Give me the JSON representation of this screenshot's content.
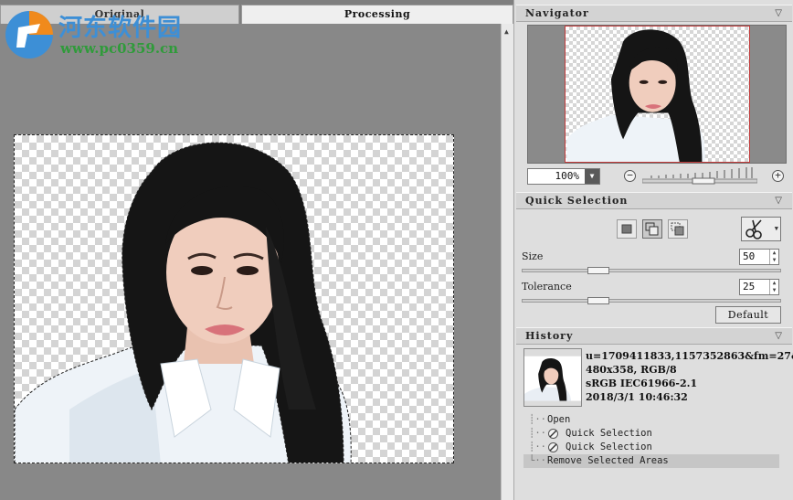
{
  "watermark": {
    "title": "河东软件园",
    "url": "www.pc0359.cn",
    "logo_icon": "watermark-logo-icon",
    "colors": {
      "blue": "#3d8fd6",
      "green": "#2f9b3a",
      "orange": "#f08a1c"
    }
  },
  "tabs": [
    {
      "label": "Original",
      "active": false
    },
    {
      "label": "Processing",
      "active": true
    }
  ],
  "navigator": {
    "title": "Navigator",
    "zoom": "100%",
    "zoom_level": 1.0
  },
  "quick_selection": {
    "title": "Quick Selection",
    "size_label": "Size",
    "size_value": "50",
    "tolerance_label": "Tolerance",
    "tolerance_value": "25",
    "default_label": "Default",
    "tool_icon": "scissors-icon"
  },
  "history": {
    "title": "History",
    "info": [
      "u=1709411833,1157352863&fm=27&",
      "480x358, RGB/8",
      "sRGB IEC61966-2.1",
      "2018/3/1 10:46:32"
    ],
    "items": [
      {
        "label": "Open",
        "icon": ""
      },
      {
        "label": "Quick Selection",
        "icon": "quick-selection-icon"
      },
      {
        "label": "Quick Selection",
        "icon": "quick-selection-icon"
      },
      {
        "label": "Remove Selected Areas",
        "icon": "",
        "selected": true
      }
    ]
  },
  "colors": {
    "canvas_bg": "#888888",
    "panel_bg": "#dedede",
    "selected_row": "#c6c6c6",
    "navigator_frame": "#c23a3a"
  }
}
